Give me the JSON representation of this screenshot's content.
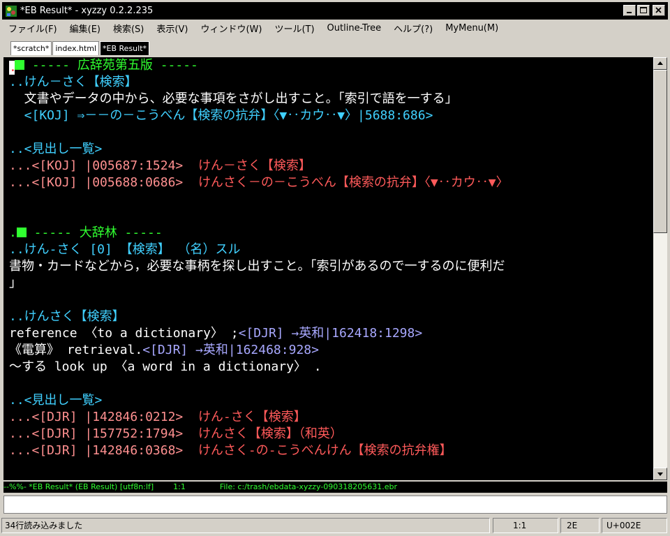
{
  "window": {
    "title": "*EB Result* - xyzzy 0.2.2.235"
  },
  "menu": [
    "ファイル(F)",
    "編集(E)",
    "検索(S)",
    "表示(V)",
    "ウィンドウ(W)",
    "ツール(T)",
    "Outline-Tree",
    "ヘルプ(?)",
    "MyMenu(M)"
  ],
  "tabs": [
    {
      "label": "*scratch*",
      "active": false
    },
    {
      "label": "index.html",
      "active": false
    },
    {
      "label": "*EB Result*",
      "active": true
    }
  ],
  "editor": {
    "lines": [
      [
        {
          "t": "cursor",
          "text": "."
        },
        {
          "t": "sq"
        },
        {
          "t": "green",
          "text": " ----- 広辞苑第五版 -----"
        }
      ],
      [
        {
          "t": "cyan",
          "text": "..けん－さく【検索】"
        }
      ],
      [
        {
          "t": "white",
          "text": "  文書やデータの中から、必要な事項をさがし出すこと。「索引で語を一する」"
        }
      ],
      [
        {
          "t": "cyan",
          "text": "  <[KOJ] ⇒－－の－こうべん【検索の抗弁】〈▼‥カウ‥▼〉|5688:686>"
        }
      ],
      [],
      [
        {
          "t": "cyan",
          "text": "..<見出し一覧>"
        }
      ],
      [
        {
          "t": "salmon",
          "text": "...<[KOJ] |005687:1524>  "
        },
        {
          "t": "pink",
          "text": "けん－さく【検索】"
        }
      ],
      [
        {
          "t": "salmon",
          "text": "...<[KOJ] |005688:0686>  "
        },
        {
          "t": "pink",
          "text": "けんさく－の－こうべん【検索の抗弁】〈▼‥カウ‥▼〉"
        }
      ],
      [],
      [],
      [
        {
          "t": "green",
          "text": "."
        },
        {
          "t": "sq"
        },
        {
          "t": "green",
          "text": " ----- 大辞林 -----"
        }
      ],
      [
        {
          "t": "cyan",
          "text": "..けん-さく [0] 【検索】 （名）スル"
        }
      ],
      [
        {
          "t": "white",
          "text": "書物・カードなどから，必要な事柄を探し出すこと。「索引があるので一するのに便利だ"
        }
      ],
      [
        {
          "t": "white",
          "text": "」"
        }
      ],
      [],
      [
        {
          "t": "cyan",
          "text": "..けんさく【検索】"
        }
      ],
      [
        {
          "t": "white",
          "text": "reference 〈to a dictionary〉 ;"
        },
        {
          "t": "lav",
          "text": "<[DJR] →英和|162418:1298>"
        }
      ],
      [
        {
          "t": "white",
          "text": "《電算》 retrieval."
        },
        {
          "t": "lav",
          "text": "<[DJR] →英和|162468:928>"
        }
      ],
      [
        {
          "t": "white",
          "text": "～する look up 〈a word in a dictionary〉 ."
        }
      ],
      [],
      [
        {
          "t": "cyan",
          "text": "..<見出し一覧>"
        }
      ],
      [
        {
          "t": "salmon",
          "text": "...<[DJR] |142846:0212>  "
        },
        {
          "t": "pink",
          "text": "けん-さく【検索】"
        }
      ],
      [
        {
          "t": "salmon",
          "text": "...<[DJR] |157752:1794>  "
        },
        {
          "t": "pink",
          "text": "けんさく【検索】（和英）"
        }
      ],
      [
        {
          "t": "salmon",
          "text": "...<[DJR] |142846:0368>  "
        },
        {
          "t": "pink",
          "text": "けんさく-の-こうべんけん【検索の抗弁権】"
        }
      ]
    ]
  },
  "modeline": "--%%- *EB Result* (EB Result) [utf8n:lf]        1:1              File: c:/trash/ebdata-xyzzy-090318205631.ebr",
  "minibuffer": "",
  "statusbar": {
    "message": "34行読み込みました",
    "position": "1:1",
    "code": "2E",
    "unicode": "U+002E"
  }
}
